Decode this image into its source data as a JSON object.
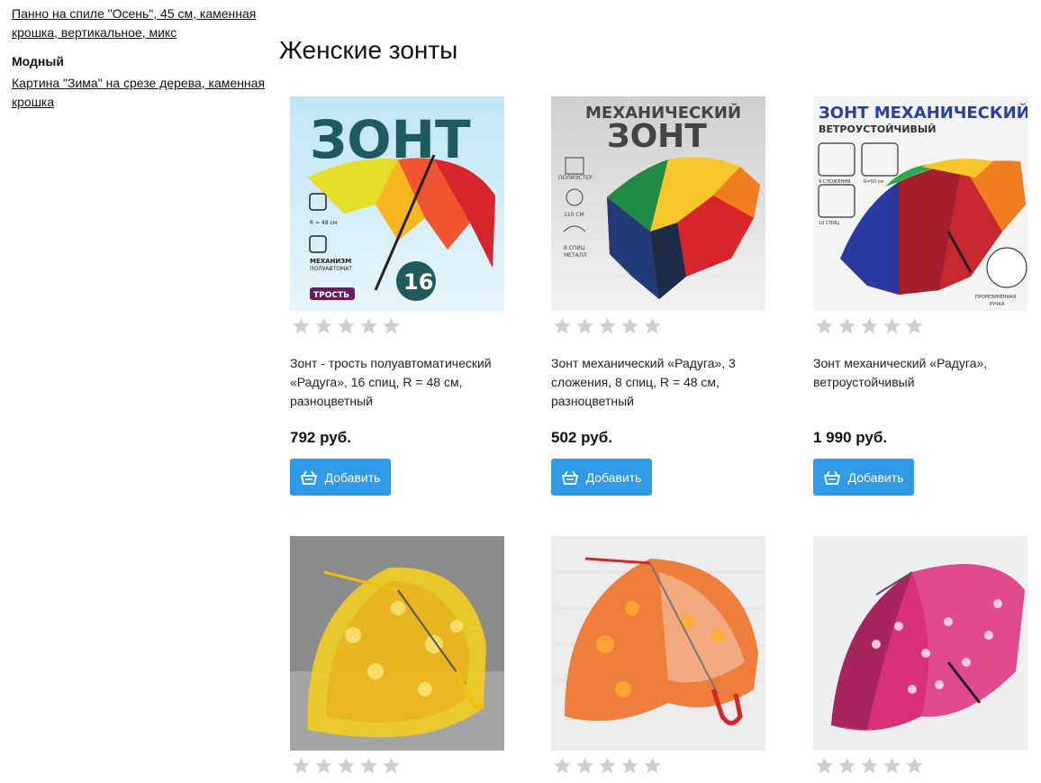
{
  "sidebar": {
    "links": [
      "Панно на спиле \"Осень\", 45 см, каменная крошка, вертикальное, микс"
    ],
    "section_label": "Модный",
    "links2": [
      "Картина \"Зима\" на срезе дерева, каменная крошка"
    ]
  },
  "main": {
    "title": "Женские зонты",
    "add_label": "Добавить",
    "products": [
      {
        "name": "Зонт - трость полуавтоматический «Радуга», 16 спиц, R = 48 см, разноцветный",
        "price": "792 руб.",
        "image_text": [
          "ЗОНТ",
          "R = 48 см",
          "МЕХАНИЗМ",
          "ПОЛУАВТОМАТ",
          "ТРОСТЬ",
          "16"
        ]
      },
      {
        "name": "Зонт механический «Радуга», 3 сложения, 8 спиц, R = 48 см, разноцветный",
        "price": "502 руб.",
        "image_text": [
          "МЕХАНИЧЕСКИЙ",
          "ЗОНТ",
          "ПОЛИЭСТЕР",
          "110 СМ",
          "8 СПИЦ",
          "МЕТАЛЛ"
        ]
      },
      {
        "name": "Зонт механический «Радуга», ветроустойчивый",
        "price": "1 990 руб.",
        "image_text": [
          "ЗОНТ МЕХАНИЧЕСКИЙ",
          "ВЕТРОУСТОЙЧИВЫЙ",
          "4 СЛОЖЕНИЯ",
          "R=50 см",
          "10 СПИЦ",
          "ПРОРЕЗИНЕННАЯ",
          "РУЧКА"
        ]
      },
      {
        "name": "",
        "price": ""
      },
      {
        "name": "",
        "price": ""
      },
      {
        "name": "",
        "price": ""
      }
    ]
  },
  "colors": {
    "button": "#2f9ae5",
    "star": "#cfcfcf"
  }
}
